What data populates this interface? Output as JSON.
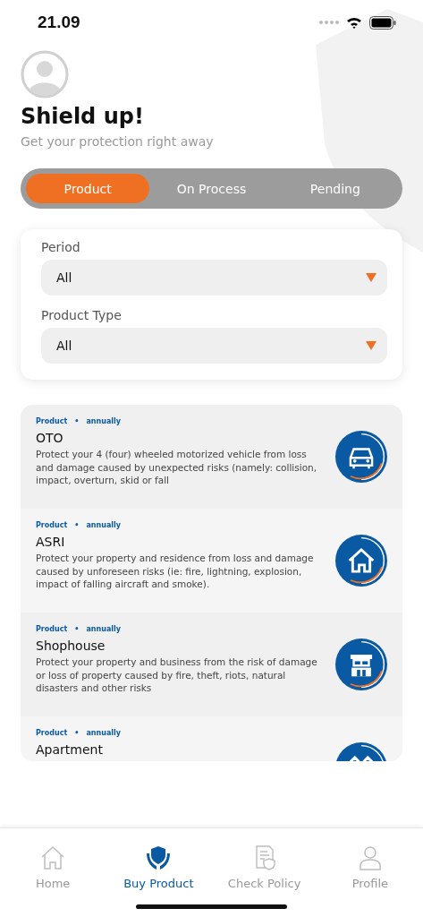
{
  "status_bar": {
    "time": "21.09"
  },
  "header": {
    "title": "Shield up!",
    "subtitle": "Get your protection right away"
  },
  "tabs": [
    {
      "label": "Product",
      "selected": true
    },
    {
      "label": "On Process",
      "selected": false
    },
    {
      "label": "Pending",
      "selected": false
    }
  ],
  "filters": [
    {
      "label": "Period",
      "value": "All"
    },
    {
      "label": "Product Type",
      "value": "All"
    }
  ],
  "products": [
    {
      "kind": "car",
      "category": "Product",
      "separator": "•",
      "period": "annually",
      "name": "OTO",
      "description": "Protect your 4 (four) wheeled motorized vehicle from loss and damage caused by unexpected risks (namely: collision, impact, overturn, skid or fall"
    },
    {
      "kind": "house",
      "category": "Product",
      "separator": "•",
      "period": "annually",
      "name": "ASRI",
      "description": "Protect your property and residence from loss and damage caused by unforeseen risks (ie: fire, lightning, explosion, impact of falling aircraft and smoke)."
    },
    {
      "kind": "shop",
      "category": "Product",
      "separator": "•",
      "period": "annually",
      "name": "Shophouse",
      "description": "Protect your property and business from the risk of damage or loss of property caused by fire, theft, riots, natural disasters and other risks"
    },
    {
      "kind": "apartment",
      "category": "Product",
      "separator": "•",
      "period": "annually",
      "name": "Apartment"
    }
  ],
  "nav": [
    {
      "kind": "home",
      "label": "Home",
      "selected": false
    },
    {
      "kind": "buy",
      "label": "Buy Product",
      "selected": true
    },
    {
      "kind": "policy",
      "label": "Check Policy",
      "selected": false
    },
    {
      "kind": "profile",
      "label": "Profile",
      "selected": false
    }
  ]
}
